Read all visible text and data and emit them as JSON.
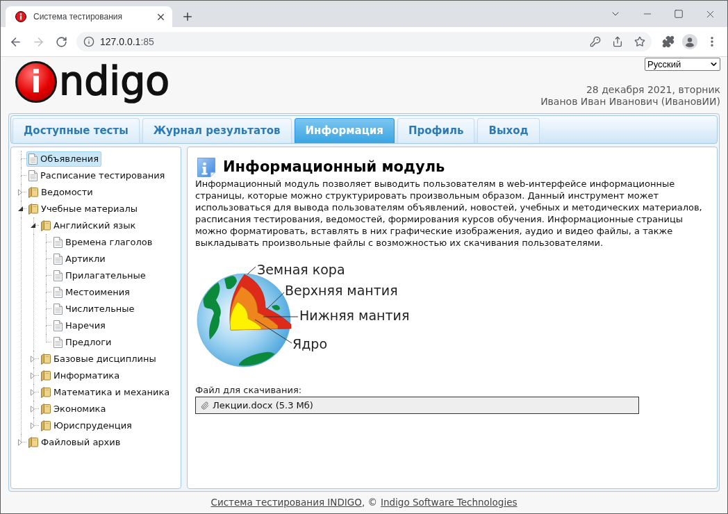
{
  "browser": {
    "tab": {
      "title": "Система тестирования"
    },
    "forward": {
      "disabled": true
    },
    "address": {
      "host": "127.0.0.1",
      "port": ":85"
    }
  },
  "header": {
    "logo": {
      "mark": "i",
      "text": "ndigo"
    },
    "language": {
      "value": "Русский"
    },
    "date": "28 декабря 2021, вторник",
    "user": "Иванов Иван Иванович (ИвановИИ)"
  },
  "tabs": [
    {
      "label": "Доступные тесты",
      "selected": false
    },
    {
      "label": "Журнал результатов",
      "selected": false
    },
    {
      "label": "Информация",
      "selected": true
    },
    {
      "label": "Профиль",
      "selected": false
    },
    {
      "label": "Выход",
      "selected": false
    }
  ],
  "tree": {
    "items": [
      {
        "kind": "page",
        "label": "Объявления",
        "selected": true
      },
      {
        "kind": "page",
        "label": "Расписание тестирования",
        "selected": false
      },
      {
        "kind": "folder",
        "label": "Ведомости",
        "expanded": false,
        "selected": false
      },
      {
        "kind": "folder",
        "label": "Учебные материалы",
        "expanded": true,
        "selected": false,
        "children": [
          {
            "kind": "folder",
            "label": "Английский язык",
            "expanded": true,
            "selected": false,
            "children": [
              {
                "kind": "page",
                "label": "Времена глаголов",
                "selected": false
              },
              {
                "kind": "page",
                "label": "Артикли",
                "selected": false
              },
              {
                "kind": "page",
                "label": "Прилагательные",
                "selected": false
              },
              {
                "kind": "page",
                "label": "Местоимения",
                "selected": false
              },
              {
                "kind": "page",
                "label": "Числительные",
                "selected": false
              },
              {
                "kind": "page",
                "label": "Наречия",
                "selected": false
              },
              {
                "kind": "page",
                "label": "Предлоги",
                "selected": false
              }
            ]
          },
          {
            "kind": "folder",
            "label": "Базовые дисциплины",
            "expanded": false,
            "selected": false
          },
          {
            "kind": "folder",
            "label": "Информатика",
            "expanded": false,
            "selected": false
          },
          {
            "kind": "folder",
            "label": "Математика и механика",
            "expanded": false,
            "selected": false
          },
          {
            "kind": "folder",
            "label": "Экономика",
            "expanded": false,
            "selected": false
          },
          {
            "kind": "folder",
            "label": "Юриспруденция",
            "expanded": false,
            "selected": false
          }
        ]
      },
      {
        "kind": "folder",
        "label": "Файловый архив",
        "expanded": false,
        "selected": false
      }
    ]
  },
  "content": {
    "title": "Информационный модуль",
    "text": "Информационный модуль позволяет выводить пользователям в web-интерфейсе информационные страницы, которые можно структурировать произвольным образом. Данный инструмент может использоваться для вывода пользователям объявлений, новостей, учебных и методических материалов, расписания тестирования, ведомостей, формирования курсов обучения. Информационные страницы можно форматировать, вставлять в них графические изображения, аудио и видео файлы, а также выкладывать произвольные файлы с возможностью их скачивания пользователями.",
    "diagram": {
      "labels": [
        "Земная кора",
        "Верхняя мантия",
        "Нижняя мантия",
        "Ядро"
      ]
    },
    "download": {
      "label": "Файл для скачивания:",
      "file": "Лекции.docx (5.3 Мб)"
    }
  },
  "footer": {
    "parts": [
      {
        "kind": "link",
        "text": "Система тестирования INDIGO"
      },
      {
        "kind": "text",
        "text": ", ©"
      },
      {
        "kind": "link",
        "text": "Indigo Software Technologies"
      }
    ]
  }
}
